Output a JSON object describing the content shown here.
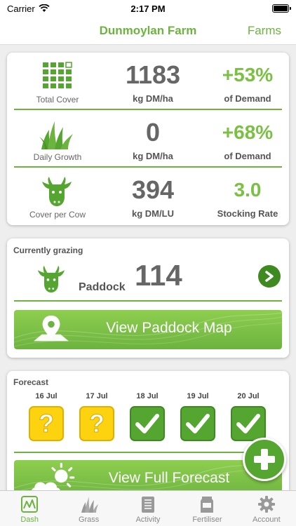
{
  "status": {
    "carrier": "Carrier",
    "time": "2:17 PM"
  },
  "nav": {
    "title": "Dunmoylan Farm",
    "right_button": "Farms"
  },
  "metrics": [
    {
      "icon": "grid-icon",
      "label": "Total Cover",
      "value": "1183",
      "unit": "kg DM/ha",
      "secondary": "+53%",
      "secondary_label": "of Demand"
    },
    {
      "icon": "grass-icon",
      "label": "Daily Growth",
      "value": "0",
      "unit": "kg DM/ha",
      "secondary": "+68%",
      "secondary_label": "of Demand"
    },
    {
      "icon": "cow-icon",
      "label": "Cover per Cow",
      "value": "394",
      "unit": "kg DM/LU",
      "secondary": "3.0",
      "secondary_label": "Stocking Rate"
    }
  ],
  "grazing": {
    "title": "Currently grazing",
    "paddock_label": "Paddock",
    "paddock_number": "114",
    "map_button": "View Paddock Map"
  },
  "forecast": {
    "title": "Forecast",
    "days": [
      {
        "date": "16 Jul",
        "status": "unknown",
        "glyph": "?"
      },
      {
        "date": "17 Jul",
        "status": "unknown",
        "glyph": "?"
      },
      {
        "date": "18 Jul",
        "status": "ok",
        "glyph": ""
      },
      {
        "date": "19 Jul",
        "status": "ok",
        "glyph": ""
      },
      {
        "date": "20 Jul",
        "status": "ok",
        "glyph": ""
      }
    ],
    "forecast_button": "View Full Forecast"
  },
  "tabs": [
    {
      "label": "Dash",
      "icon": "dashboard-icon",
      "active": true
    },
    {
      "label": "Grass",
      "icon": "grass-icon",
      "active": false
    },
    {
      "label": "Activity",
      "icon": "clipboard-icon",
      "active": false
    },
    {
      "label": "Fertiliser",
      "icon": "fertiliser-bag-icon",
      "active": false
    },
    {
      "label": "Account",
      "icon": "gear-icon",
      "active": false
    }
  ],
  "colors": {
    "brand_green": "#6cb33f",
    "bright_green": "#7ac143",
    "check_green": "#55a630",
    "warning_yellow": "#fdd20e"
  }
}
